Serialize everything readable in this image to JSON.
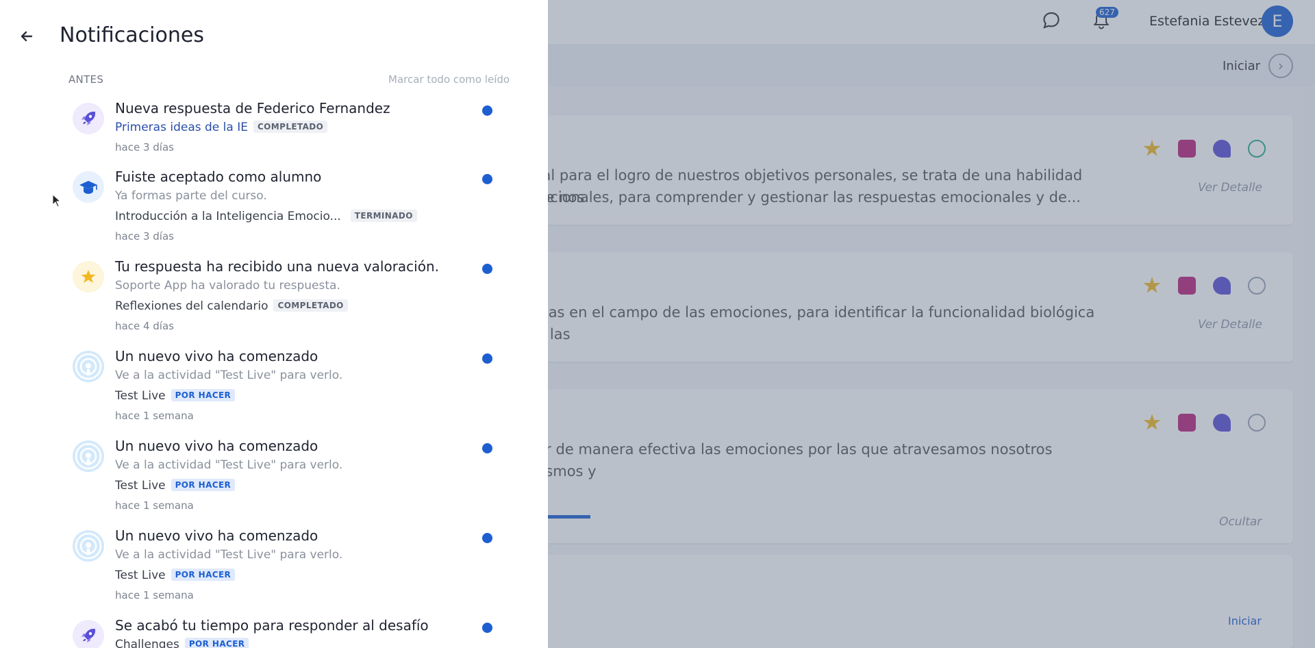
{
  "background": {
    "user_name": "Estefania Estevez",
    "avatar_letter": "E",
    "notifications_count": "627",
    "start_label": "Iniciar",
    "cards": [
      {
        "line1": "ntal para el logro de nuestros objetivos personales, se trata de una habilidad que nos",
        "line2": "mocionales, para comprender y gestionar las respuestas emocionales y de...",
        "detail": "Ver Detalle"
      },
      {
        "line1": "ncias en el campo de las emociones, para identificar la funcionalidad biológica de las",
        "line2": "s",
        "detail": "Ver Detalle"
      },
      {
        "line1": "nar de manera efectiva las emociones por las que atravesamos nosotros mismos y",
        "line2": "",
        "detail": ""
      }
    ],
    "hide_label": "Ocultar",
    "start_link": "Iniciar"
  },
  "panel": {
    "title": "Notificaciones",
    "section": "ANTES",
    "mark_all": "Marcar todo como leído",
    "items": [
      {
        "icon": "rocket-icon",
        "title": "Nueva respuesta de Federico Fernandez",
        "context": "Primeras ideas de la IE",
        "tag": "COMPLETADO",
        "time": "hace 3 días"
      },
      {
        "icon": "graduation-cap-icon",
        "title": "Fuiste aceptado como alumno",
        "subtitle": "Ya formas parte del curso.",
        "context": "Introducción a la Inteligencia Emocio...",
        "tag": "TERMINADO",
        "time": "hace 3 días"
      },
      {
        "icon": "star-icon",
        "title": "Tu respuesta ha recibido una nueva valoración.",
        "subtitle": "Soporte App ha valorado tu respuesta.",
        "context": "Reflexiones del calendario",
        "tag": "COMPLETADO",
        "time": "hace 4 días"
      },
      {
        "icon": "live-broadcast-icon",
        "title": "Un nuevo vivo ha comenzado",
        "subtitle": "Ve a la actividad \"Test Live\" para verlo.",
        "context": "Test Live",
        "tag": "POR HACER",
        "time": "hace 1 semana"
      },
      {
        "icon": "live-broadcast-icon",
        "title": "Un nuevo vivo ha comenzado",
        "subtitle": "Ve a la actividad \"Test Live\" para verlo.",
        "context": "Test Live",
        "tag": "POR HACER",
        "time": "hace 1 semana"
      },
      {
        "icon": "live-broadcast-icon",
        "title": "Un nuevo vivo ha comenzado",
        "subtitle": "Ve a la actividad \"Test Live\" para verlo.",
        "context": "Test Live",
        "tag": "POR HACER",
        "time": "hace 1 semana"
      },
      {
        "icon": "rocket-icon",
        "title": "Se acabó tu tiempo para responder al desafío",
        "context": "Challenges",
        "tag": "POR HACER"
      }
    ]
  },
  "colors": {
    "accent": "#1d5fd1",
    "unread_dot": "#1d5fd1",
    "star": "#f2b822",
    "chat": "#b8247a",
    "rocket": "#5a4fd6"
  }
}
